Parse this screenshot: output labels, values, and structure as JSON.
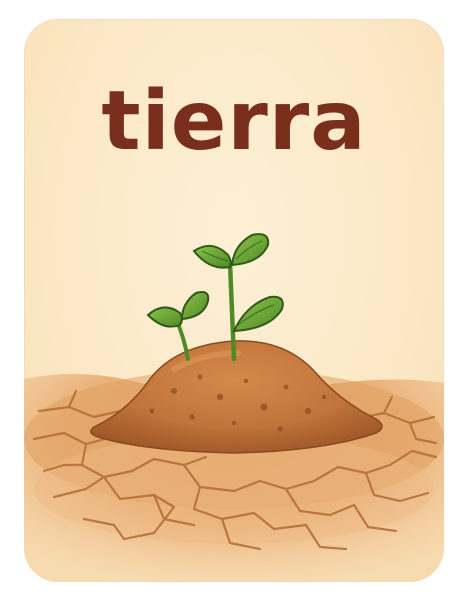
{
  "card": {
    "word": "tierra"
  },
  "colors": {
    "card_background": "#fbe6c2",
    "word_color": "#7a2e1c",
    "soil": "#c77a3c",
    "soil_shadow": "#9c5626",
    "leaf": "#6aa636",
    "leaf_outline": "#2f5a1a",
    "crack": "#b5703a"
  },
  "illustration": {
    "subject": "seedlings-in-soil-mound-icon"
  }
}
